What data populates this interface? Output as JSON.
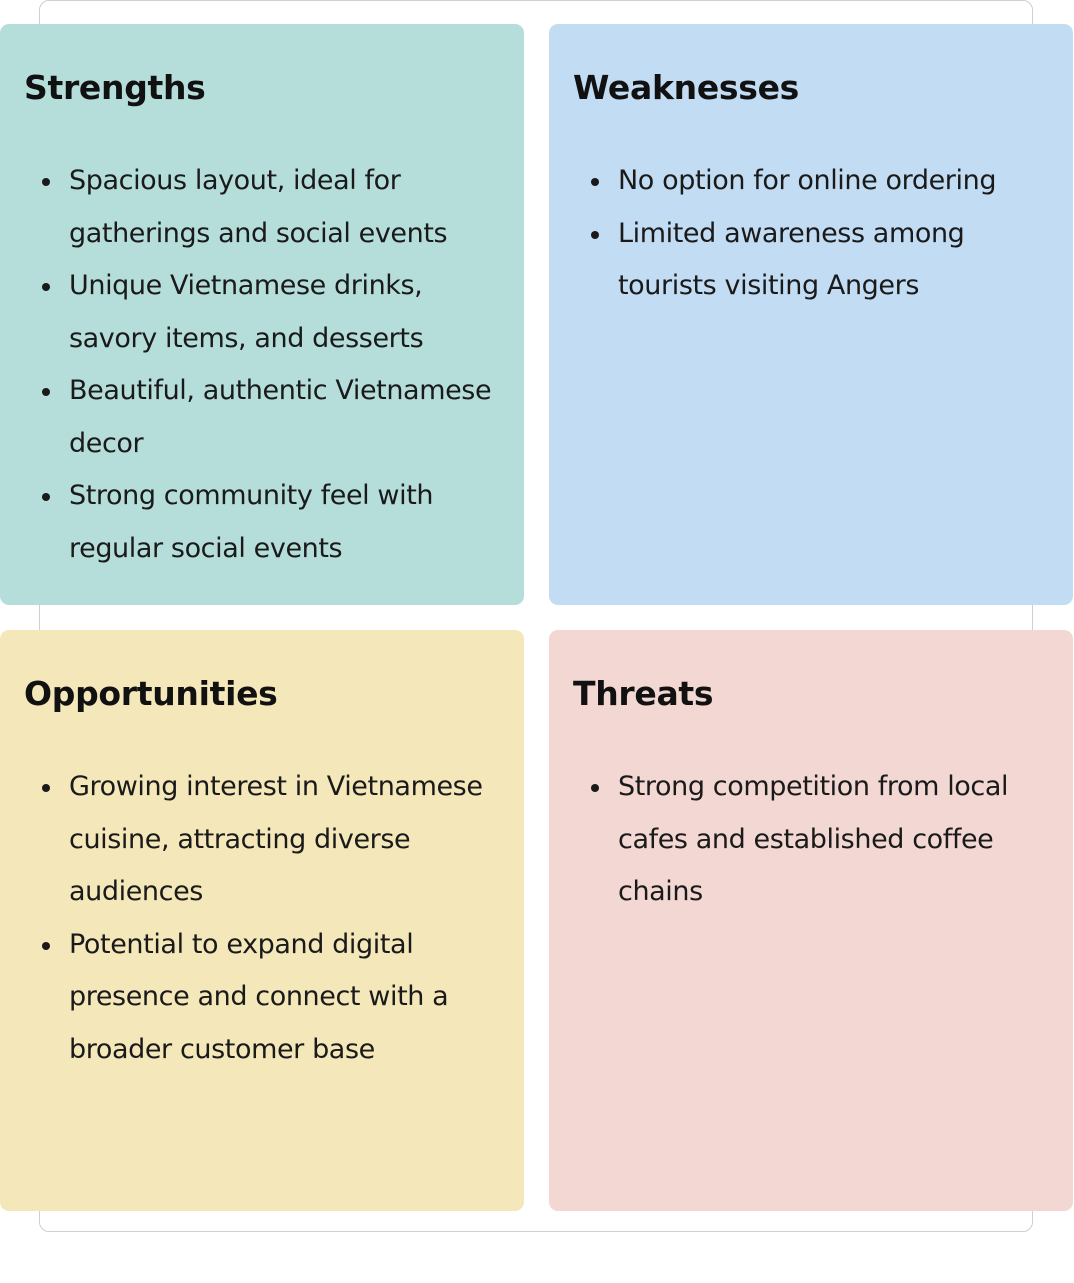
{
  "swot": {
    "strengths": {
      "title": "Strengths",
      "items": [
        "Spacious layout, ideal for gatherings and social events",
        "Unique Vietnamese drinks, savory items, and desserts",
        "Beautiful, authentic Vietnamese decor",
        "Strong community feel with regular social events"
      ]
    },
    "weaknesses": {
      "title": "Weaknesses",
      "items": [
        "No option for online ordering",
        "Limited awareness among tourists visiting Angers"
      ]
    },
    "opportunities": {
      "title": "Opportunities",
      "items": [
        "Growing interest in Vietnamese cuisine, attracting diverse audiences",
        "Potential to expand digital presence and connect with a broader customer base"
      ]
    },
    "threats": {
      "title": "Threats",
      "items": [
        "Strong competition from local cafes and established coffee chains"
      ]
    }
  },
  "colors": {
    "strengths": "#b5dedb",
    "weaknesses": "#c2dcf3",
    "opportunities": "#f4e7b9",
    "threats": "#f2d7d2"
  }
}
